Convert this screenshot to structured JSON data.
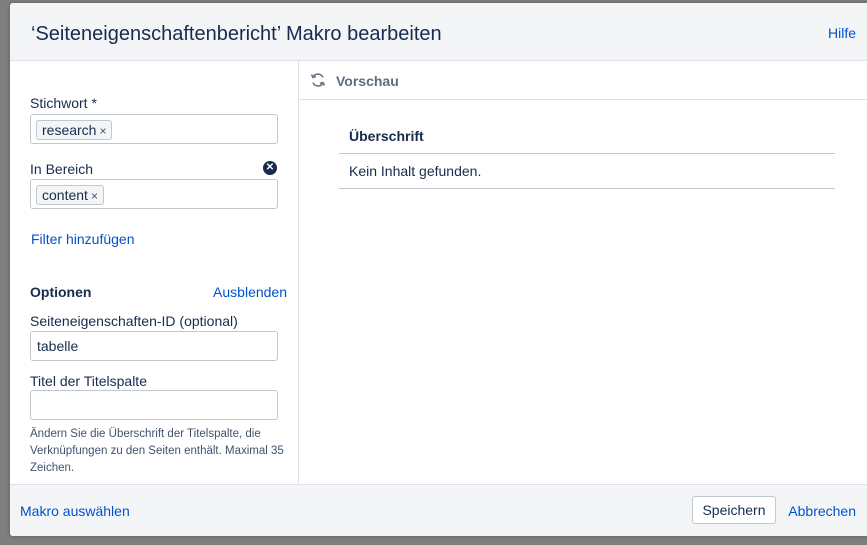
{
  "dialog": {
    "title": "‘Seiteneigenschaftenbericht’ Makro bearbeiten",
    "help": "Hilfe"
  },
  "form": {
    "keyword_label": "Stichwort *",
    "keyword_chip": "research",
    "space_label": "In Bereich",
    "space_chip": "content",
    "chip_remove": "×",
    "add_filter": "Filter hinzufügen",
    "options_label": "Optionen",
    "hide_options": "Ausblenden",
    "id_label": "Seiteneigenschaften-ID (optional)",
    "id_value": "tabelle",
    "title_col_label": "Titel der Titelspalte",
    "title_col_value": "",
    "hint": "Ändern Sie die Überschrift der Titelspalte, die Verknüpfungen zu den Seiten enthält. Maximal 35 Zeichen."
  },
  "preview": {
    "title": "Vorschau",
    "column_header": "Überschrift",
    "empty_text": "Kein Inhalt gefunden."
  },
  "footer": {
    "select_macro": "Makro auswählen",
    "save": "Speichern",
    "cancel": "Abbrechen"
  },
  "icons": {
    "refresh": "refresh-icon",
    "clear": "clear-icon",
    "remove": "close-icon"
  },
  "colors": {
    "link": "#0052cc",
    "text": "#172b4d",
    "header_bg": "#f4f5f7",
    "overlay": "#7f7f7f"
  }
}
